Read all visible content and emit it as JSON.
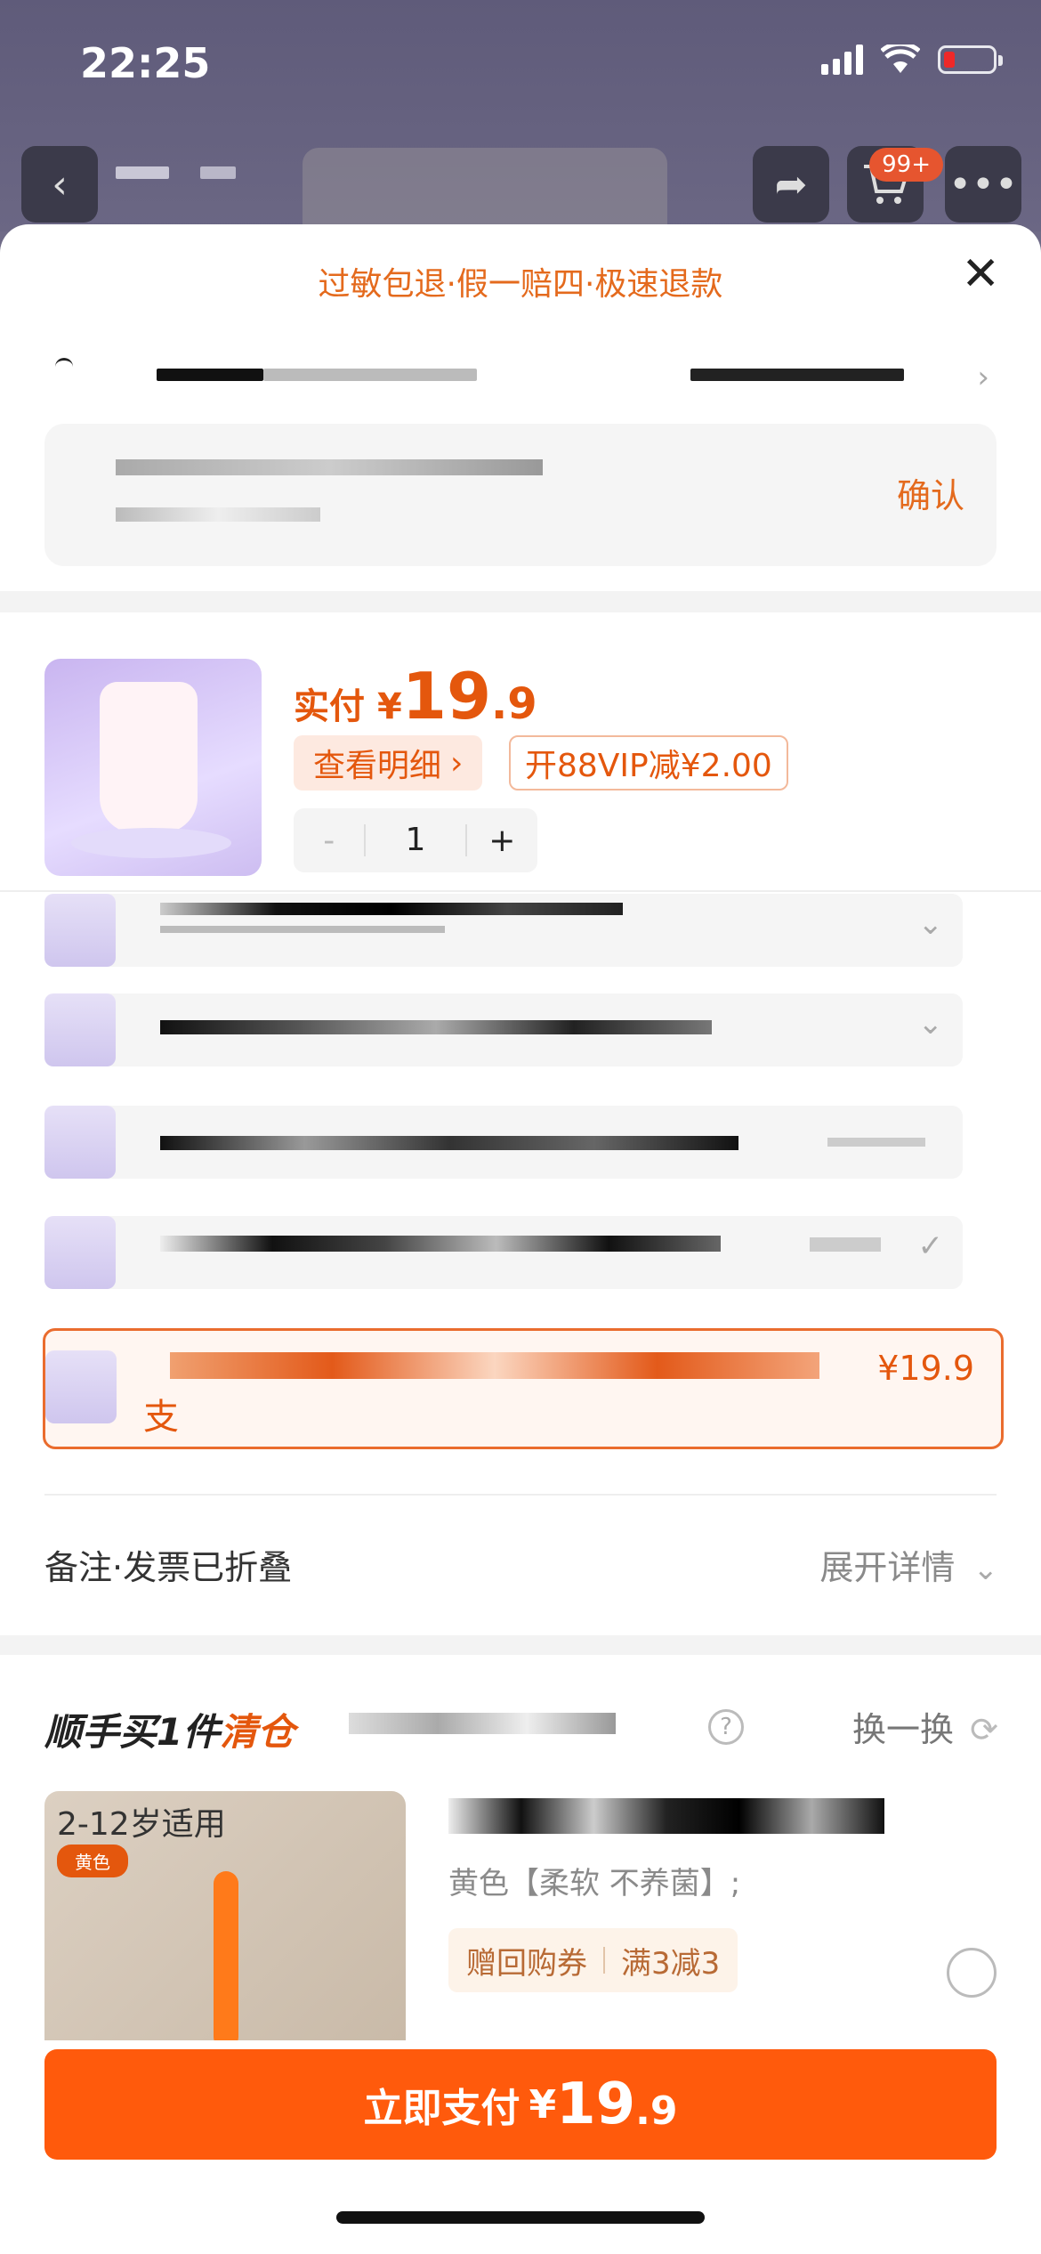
{
  "status_bar": {
    "time": "22:25"
  },
  "nav": {
    "cart_badge": "99+"
  },
  "sheet": {
    "promo": "过敏包退·假一赔四·极速退款",
    "confirm_label": "确认"
  },
  "product": {
    "price_prefix": "实付",
    "currency": "¥",
    "price_int": "19",
    "price_dec": ".9",
    "detail_label": "查看明细",
    "vip_label": "开88VIP减¥2.00",
    "quantity": "1",
    "minus": "-",
    "plus": "+"
  },
  "selected_sku": {
    "price": "¥19.9",
    "suffix": "支"
  },
  "notes": {
    "label": "备注·发票已折叠",
    "expand_label": "展开详情"
  },
  "addon": {
    "title_a": "顺手买1件",
    "title_b": "清仓",
    "swap_label": "换一换",
    "age_label": "2-12岁适用",
    "color_tag": "黄色",
    "spec": "黄色【柔软 不养菌】;",
    "coupon_a": "赠回购券",
    "coupon_b": "满3减3"
  },
  "pay": {
    "label": "立即支付",
    "currency": "¥",
    "amount_int": "19",
    "amount_dec": ".9"
  },
  "colors": {
    "accent": "#e4570d",
    "pay_button": "#ff5a0c"
  }
}
